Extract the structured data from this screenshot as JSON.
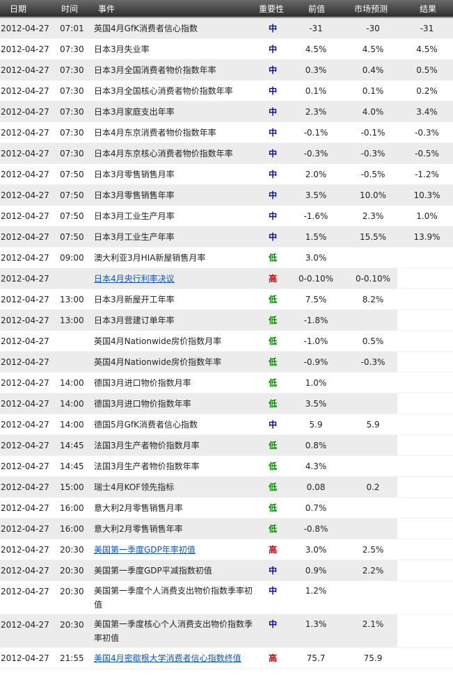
{
  "header": {
    "date": "日期",
    "time": "时间",
    "event": "事件",
    "importance": "重要性",
    "previous": "前值",
    "forecast": "市场预测",
    "result": "结果"
  },
  "colors": {
    "mid": "#0000cc",
    "low": "#008800",
    "high": "#cc0000"
  },
  "rows": [
    {
      "date": "2012-04-27",
      "time": "07:01",
      "event": "英国4月GfK消费者信心指数",
      "importance": "中",
      "previous": "-31",
      "forecast": "-30",
      "result": "-31",
      "link": false
    },
    {
      "date": "2012-04-27",
      "time": "07:30",
      "event": "日本3月失业率",
      "importance": "中",
      "previous": "4.5%",
      "forecast": "4.5%",
      "result": "4.5%",
      "link": false
    },
    {
      "date": "2012-04-27",
      "time": "07:30",
      "event": "日本3月全国消费者物价指数年率",
      "importance": "中",
      "previous": "0.3%",
      "forecast": "0.4%",
      "result": "0.5%",
      "link": false
    },
    {
      "date": "2012-04-27",
      "time": "07:30",
      "event": "日本3月全国核心消费者物价指数年率",
      "importance": "中",
      "previous": "0.1%",
      "forecast": "0.1%",
      "result": "0.2%",
      "link": false
    },
    {
      "date": "2012-04-27",
      "time": "07:30",
      "event": "日本3月家庭支出年率",
      "importance": "中",
      "previous": "2.3%",
      "forecast": "4.0%",
      "result": "3.4%",
      "link": false
    },
    {
      "date": "2012-04-27",
      "time": "07:30",
      "event": "日本4月东京消费者物价指数年率",
      "importance": "中",
      "previous": "-0.1%",
      "forecast": "-0.1%",
      "result": "-0.3%",
      "link": false
    },
    {
      "date": "2012-04-27",
      "time": "07:30",
      "event": "日本4月东京核心消费者物价指数年率",
      "importance": "中",
      "previous": "-0.3%",
      "forecast": "-0.3%",
      "result": "-0.5%",
      "link": false
    },
    {
      "date": "2012-04-27",
      "time": "07:50",
      "event": "日本3月零售销售月率",
      "importance": "中",
      "previous": "2.0%",
      "forecast": "-0.5%",
      "result": "-1.2%",
      "link": false
    },
    {
      "date": "2012-04-27",
      "time": "07:50",
      "event": "日本3月零售销售年率",
      "importance": "中",
      "previous": "3.5%",
      "forecast": "10.0%",
      "result": "10.3%",
      "link": false
    },
    {
      "date": "2012-04-27",
      "time": "07:50",
      "event": "日本3月工业生产月率",
      "importance": "中",
      "previous": "-1.6%",
      "forecast": "2.3%",
      "result": "1.0%",
      "link": false
    },
    {
      "date": "2012-04-27",
      "time": "07:50",
      "event": "日本3月工业生产年率",
      "importance": "中",
      "previous": "1.5%",
      "forecast": "15.5%",
      "result": "13.9%",
      "link": false
    },
    {
      "date": "2012-04-27",
      "time": "09:00",
      "event": "澳大利亚3月HIA新屋销售月率",
      "importance": "低",
      "previous": "3.0%",
      "forecast": "",
      "result": "",
      "link": false
    },
    {
      "date": "2012-04-27",
      "time": "",
      "event": "日本4月央行利率决议",
      "importance": "高",
      "previous": "0-0.10%",
      "forecast": "0-0.10%",
      "result": "",
      "link": true
    },
    {
      "date": "2012-04-27",
      "time": "13:00",
      "event": "日本3月新屋开工年率",
      "importance": "低",
      "previous": "7.5%",
      "forecast": "8.2%",
      "result": "",
      "link": false
    },
    {
      "date": "2012-04-27",
      "time": "13:00",
      "event": "日本3月营建订单年率",
      "importance": "低",
      "previous": "-1.8%",
      "forecast": "",
      "result": "",
      "link": false
    },
    {
      "date": "2012-04-27",
      "time": "",
      "event": "英国4月Nationwide房价指数月率",
      "importance": "低",
      "previous": "-1.0%",
      "forecast": "0.5%",
      "result": "",
      "link": false
    },
    {
      "date": "2012-04-27",
      "time": "",
      "event": "英国4月Nationwide房价指数年率",
      "importance": "低",
      "previous": "-0.9%",
      "forecast": "-0.3%",
      "result": "",
      "link": false
    },
    {
      "date": "2012-04-27",
      "time": "14:00",
      "event": "德国3月进口物价指数月率",
      "importance": "低",
      "previous": "1.0%",
      "forecast": "",
      "result": "",
      "link": false
    },
    {
      "date": "2012-04-27",
      "time": "14:00",
      "event": "德国3月进口物价指数年率",
      "importance": "低",
      "previous": "3.5%",
      "forecast": "",
      "result": "",
      "link": false
    },
    {
      "date": "2012-04-27",
      "time": "14:00",
      "event": "德国5月GfK消费者信心指数",
      "importance": "中",
      "previous": "5.9",
      "forecast": "5.9",
      "result": "",
      "link": false
    },
    {
      "date": "2012-04-27",
      "time": "14:45",
      "event": "法国3月生产者物价指数月率",
      "importance": "低",
      "previous": "0.8%",
      "forecast": "",
      "result": "",
      "link": false
    },
    {
      "date": "2012-04-27",
      "time": "14:45",
      "event": "法国3月生产者物价指数年率",
      "importance": "低",
      "previous": "4.3%",
      "forecast": "",
      "result": "",
      "link": false
    },
    {
      "date": "2012-04-27",
      "time": "15:00",
      "event": "瑞士4月KOF领先指标",
      "importance": "低",
      "previous": "0.08",
      "forecast": "0.2",
      "result": "",
      "link": false
    },
    {
      "date": "2012-04-27",
      "time": "16:00",
      "event": "意大利2月零售销售月率",
      "importance": "低",
      "previous": "0.7%",
      "forecast": "",
      "result": "",
      "link": false
    },
    {
      "date": "2012-04-27",
      "time": "16:00",
      "event": "意大利2月零售销售年率",
      "importance": "低",
      "previous": "-0.8%",
      "forecast": "",
      "result": "",
      "link": false
    },
    {
      "date": "2012-04-27",
      "time": "20:30",
      "event": "美国第一季度GDP年率初值",
      "importance": "高",
      "previous": "3.0%",
      "forecast": "2.5%",
      "result": "",
      "link": true
    },
    {
      "date": "2012-04-27",
      "time": "20:30",
      "event": "美国第一季度GDP平减指数初值",
      "importance": "中",
      "previous": "0.9%",
      "forecast": "2.2%",
      "result": "",
      "link": false
    },
    {
      "date": "2012-04-27",
      "time": "20:30",
      "event": "美国第一季度个人消费支出物价指数季率初值",
      "importance": "中",
      "previous": "1.2%",
      "forecast": "",
      "result": "",
      "link": false,
      "tall": true
    },
    {
      "date": "2012-04-27",
      "time": "20:30",
      "event": "美国第一季度核心个人消费支出物价指数季率初值",
      "importance": "中",
      "previous": "1.3%",
      "forecast": "2.1%",
      "result": "",
      "link": false,
      "tall": true
    },
    {
      "date": "2012-04-27",
      "time": "21:55",
      "event": "美国4月密歇根大学消费者信心指数终值",
      "importance": "高",
      "previous": "75.7",
      "forecast": "75.9",
      "result": "",
      "link": true
    }
  ]
}
